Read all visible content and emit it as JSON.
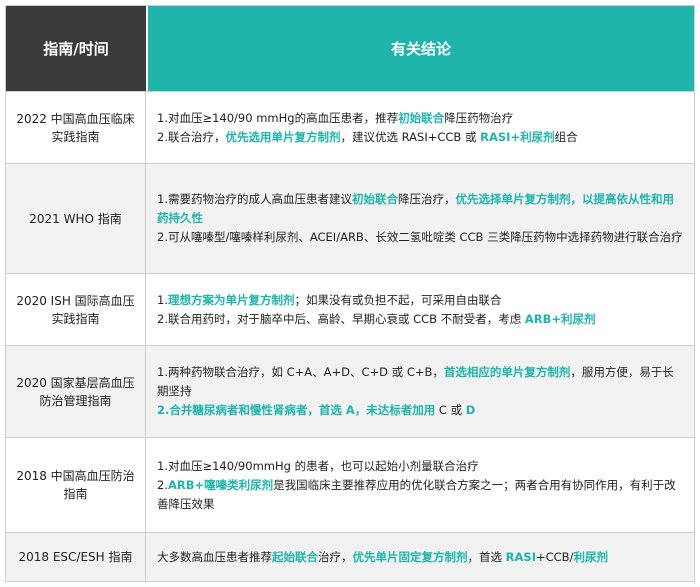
{
  "header": {
    "left": "指南/时间",
    "right": "有关结论"
  },
  "colors": {
    "header_left": "#3a3a3a",
    "header_right": "#1fb5ad",
    "highlight": "#1fb5ad"
  },
  "rows": [
    {
      "guide": "2022 中国高血压临床实践指南",
      "lines": [
        [
          {
            "t": "1.对血压≥140/90 mmHg的高血压患者，推荐"
          },
          {
            "t": "初始联合",
            "h": true
          },
          {
            "t": "降压药物治疗"
          }
        ],
        [
          {
            "t": "2.联合治疗，"
          },
          {
            "t": "优先选用单片复方制剂",
            "h": true
          },
          {
            "t": "，建议优选 RASI+CCB 或 "
          },
          {
            "t": "RASI+利尿剂",
            "h": true
          },
          {
            "t": "组合"
          }
        ]
      ]
    },
    {
      "guide": "2021 WHO 指南",
      "lines": [
        [
          {
            "t": "1.需要药物治疗的成人高血压患者建议"
          },
          {
            "t": "初始联合",
            "h": true
          },
          {
            "t": "降压治疗，"
          },
          {
            "t": "优先选择单片复方制剂，以提高依从性和用药持久性",
            "h": true
          }
        ],
        [
          {
            "t": "2.可从噻嗪型/噻嗪样利尿剂、ACEI/ARB、长效二氢吡啶类 CCB 三类降压药物中选择药物进行联合治疗"
          }
        ]
      ]
    },
    {
      "guide": "2020 ISH 国际高血压实践指南",
      "lines": [
        [
          {
            "t": "1."
          },
          {
            "t": "理想方案为单片复方制剂",
            "h": true
          },
          {
            "t": "；如果没有或负担不起，可采用自由联合"
          }
        ],
        [
          {
            "t": "2.联合用药时，对于脑卒中后、高龄、早期心衰或 CCB 不耐受者，考虑 "
          },
          {
            "t": "ARB+利尿剂",
            "h": true
          }
        ]
      ]
    },
    {
      "guide": "2020 国家基层高血压防治管理指南",
      "lines": [
        [
          {
            "t": "1.两种药物联合治疗，如 C+A、A+D、C+D 或 C+B，"
          },
          {
            "t": "首选相应的单片复方制剂",
            "h": true
          },
          {
            "t": "，服用方便，易于长期坚持"
          }
        ],
        [
          {
            "t": "2.合并糖尿病者和慢性肾病者，首选 A，未达标者加用",
            "h": true
          },
          {
            "t": " C 或 "
          },
          {
            "t": "D",
            "h": true
          }
        ]
      ]
    },
    {
      "guide": "2018 中国高血压防治指南",
      "lines": [
        [
          {
            "t": "1.对血压≥140/90mmHg 的患者，也可以起始小剂量联合治疗"
          }
        ],
        [
          {
            "t": "2."
          },
          {
            "t": "ARB+噻嗪类利尿剂",
            "h": true
          },
          {
            "t": "是我国临床主要推荐应用的优化联合方案之一；两者合用有协同作用，有利于改善降压效果"
          }
        ]
      ]
    },
    {
      "guide": "2018 ESC/ESH 指南",
      "lines": [
        [
          {
            "t": "大多数高血压患者推荐"
          },
          {
            "t": "起始联合",
            "h": true
          },
          {
            "t": "治疗，"
          },
          {
            "t": "优先单片固定复方制剂",
            "h": true
          },
          {
            "t": "，首选 "
          },
          {
            "t": "RASI",
            "h": true
          },
          {
            "t": "+CCB/"
          },
          {
            "t": "利尿剂",
            "h": true
          }
        ]
      ]
    }
  ]
}
